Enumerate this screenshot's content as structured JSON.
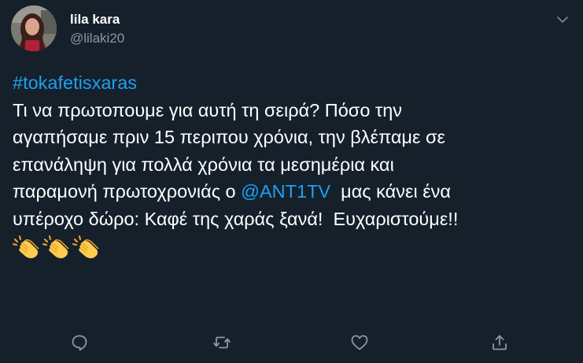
{
  "user": {
    "display_name": "lila kara",
    "handle": "@lilaki20",
    "avatar_icon": "profile-photo-avatar"
  },
  "tweet": {
    "hashtag": "#tokafetisxaras",
    "lines": [
      "Τι να πρωτοπουμε για αυτή τη σειρά? Πόσο την",
      "αγαπήσαμε πριν 15 περιπου χρόνια, την βλέπαμε σε",
      "επανάληψη για πολλά χρόνια τα μεσημέρια και"
    ],
    "line4_before": "παραμονή πρωτοχρονιάς ο ",
    "mention": "@ANT1TV",
    "line4_after": "  μας κάνει ένα",
    "line5": "υπέροχο δώρο: Καφέ της χαράς ξανά!  Ευχαριστούμε!!",
    "emojis": [
      "clapping-hands-icon",
      "clapping-hands-icon",
      "clapping-hands-icon"
    ]
  },
  "actions": {
    "icons": [
      "reply-icon",
      "retweet-icon",
      "like-icon",
      "share-icon"
    ]
  },
  "colors": {
    "background": "#15202b",
    "text": "#ffffff",
    "secondary_text": "#8899a6",
    "link": "#1da1f2"
  }
}
